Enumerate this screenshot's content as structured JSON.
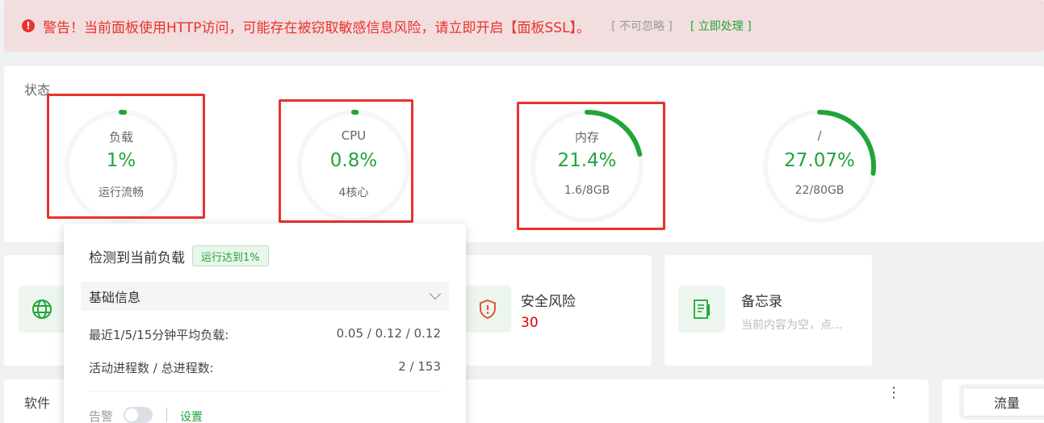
{
  "alert": {
    "message": "警告！当前面板使用HTTP访问，可能存在被窃取敏感信息风险，请立即开启【面板SSL】。",
    "ignore": "[ 不可忽略 ]",
    "handle": "[ 立即处理 ]"
  },
  "status": {
    "title": "状态",
    "gauges": [
      {
        "label": "负载",
        "value": "1%",
        "sub": "运行流畅",
        "percent": 1
      },
      {
        "label": "CPU",
        "value": "0.8%",
        "sub": "4核心",
        "percent": 0.8
      },
      {
        "label": "内存",
        "value": "21.4%",
        "sub": "1.6/8GB",
        "percent": 21.4
      },
      {
        "label": "/",
        "value": "27.07%",
        "sub": "22/80GB",
        "percent": 27.07
      }
    ]
  },
  "cards": {
    "security": {
      "title": "安全风险",
      "value": "30"
    },
    "memo": {
      "title": "备忘录",
      "desc": "当前内容为空，点..."
    }
  },
  "software": {
    "title": "软件",
    "more": "⋮"
  },
  "flow": {
    "tab": "流量"
  },
  "popup": {
    "title": "检测到当前负载",
    "badge": "运行达到1%",
    "section": "基础信息",
    "rows": [
      {
        "label": "最近1/5/15分钟平均负载:",
        "value": "0.05 / 0.12 / 0.12"
      },
      {
        "label": "活动进程数 / 总进程数:",
        "value": "2 / 153"
      }
    ],
    "alarm_label": "告警",
    "settings_label": "设置"
  },
  "colors": {
    "accent": "#20a53a",
    "danger": "#e8322e",
    "track": "#f5f6fa"
  }
}
